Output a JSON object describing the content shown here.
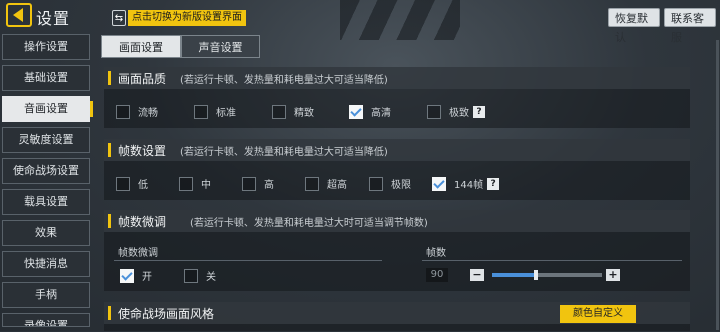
{
  "header": {
    "title": "设置",
    "switch_label": "点击切换为新版设置界面",
    "reset_label": "恢复默认",
    "service_label": "联系客服"
  },
  "sidebar": {
    "items": [
      {
        "label": "操作设置"
      },
      {
        "label": "基础设置"
      },
      {
        "label": "音画设置",
        "active": true
      },
      {
        "label": "灵敏度设置"
      },
      {
        "label": "使命战场设置"
      },
      {
        "label": "载具设置"
      },
      {
        "label": "效果"
      },
      {
        "label": "快捷消息"
      },
      {
        "label": "手柄"
      },
      {
        "label": "录像设置"
      }
    ]
  },
  "tabs": [
    {
      "label": "画面设置",
      "active": true
    },
    {
      "label": "声音设置",
      "active": false
    }
  ],
  "quality": {
    "title": "画面品质",
    "note": "(若运行卡顿、发热量和耗电量过大可适当降低)",
    "options": [
      {
        "label": "流畅",
        "checked": false
      },
      {
        "label": "标准",
        "checked": false
      },
      {
        "label": "精致",
        "checked": false
      },
      {
        "label": "高清",
        "checked": true
      },
      {
        "label": "极致",
        "checked": false
      }
    ],
    "help": "?"
  },
  "fps": {
    "title": "帧数设置",
    "note": "(若运行卡顿、发热量和耗电量过大可适当降低)",
    "options": [
      {
        "label": "低",
        "checked": false
      },
      {
        "label": "中",
        "checked": false
      },
      {
        "label": "高",
        "checked": false
      },
      {
        "label": "超高",
        "checked": false
      },
      {
        "label": "极限",
        "checked": false
      },
      {
        "label": "144帧",
        "checked": true
      }
    ],
    "help": "?"
  },
  "fine_tune": {
    "title": "帧数微调",
    "note": "(若运行卡顿、发热量和耗电量过大时可适当调节帧数)",
    "sub_left_label": "帧数微调",
    "on_label": "开",
    "off_label": "关",
    "on_checked": true,
    "sub_right_label": "帧数",
    "value": "90",
    "minus": "−",
    "plus": "+",
    "slider_level": 0.4
  },
  "battlefield": {
    "title": "使命战场画面风格",
    "color_button": "颜色自定义"
  },
  "colors": {
    "accent": "#f1c40f",
    "check_blue": "#4a90d9"
  }
}
